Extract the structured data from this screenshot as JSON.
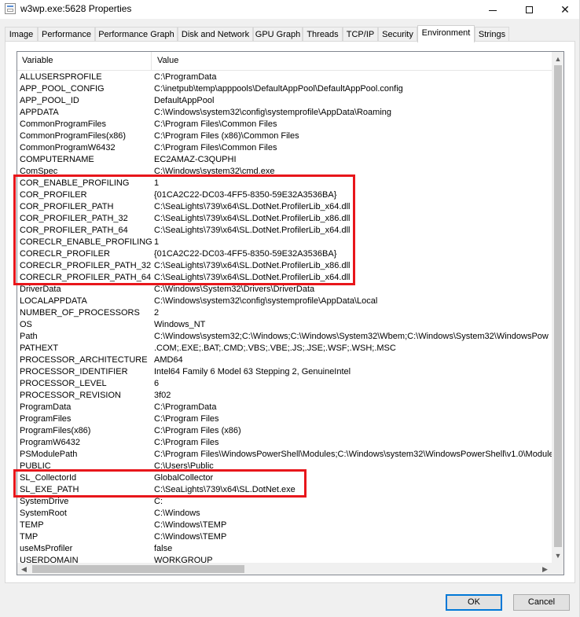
{
  "window": {
    "title": "w3wp.exe:5628 Properties"
  },
  "tabs": [
    {
      "label": "Image"
    },
    {
      "label": "Performance"
    },
    {
      "label": "Performance Graph"
    },
    {
      "label": "Disk and Network"
    },
    {
      "label": "GPU Graph"
    },
    {
      "label": "Threads"
    },
    {
      "label": "TCP/IP"
    },
    {
      "label": "Security"
    },
    {
      "label": "Environment"
    },
    {
      "label": "Strings"
    }
  ],
  "active_tab": "Environment",
  "table": {
    "columns": [
      "Variable",
      "Value"
    ],
    "rows": [
      [
        "ALLUSERSPROFILE",
        "C:\\ProgramData"
      ],
      [
        "APP_POOL_CONFIG",
        "C:\\inetpub\\temp\\apppools\\DefaultAppPool\\DefaultAppPool.config"
      ],
      [
        "APP_POOL_ID",
        "DefaultAppPool"
      ],
      [
        "APPDATA",
        "C:\\Windows\\system32\\config\\systemprofile\\AppData\\Roaming"
      ],
      [
        "CommonProgramFiles",
        "C:\\Program Files\\Common Files"
      ],
      [
        "CommonProgramFiles(x86)",
        "C:\\Program Files (x86)\\Common Files"
      ],
      [
        "CommonProgramW6432",
        "C:\\Program Files\\Common Files"
      ],
      [
        "COMPUTERNAME",
        "EC2AMAZ-C3QUPHI"
      ],
      [
        "ComSpec",
        "C:\\Windows\\system32\\cmd.exe"
      ],
      [
        "COR_ENABLE_PROFILING",
        "1"
      ],
      [
        "COR_PROFILER",
        "{01CA2C22-DC03-4FF5-8350-59E32A3536BA}"
      ],
      [
        "COR_PROFILER_PATH",
        "C:\\SeaLights\\739\\x64\\SL.DotNet.ProfilerLib_x64.dll"
      ],
      [
        "COR_PROFILER_PATH_32",
        "C:\\SeaLights\\739\\x64\\SL.DotNet.ProfilerLib_x86.dll"
      ],
      [
        "COR_PROFILER_PATH_64",
        "C:\\SeaLights\\739\\x64\\SL.DotNet.ProfilerLib_x64.dll"
      ],
      [
        "CORECLR_ENABLE_PROFILING",
        "1"
      ],
      [
        "CORECLR_PROFILER",
        "{01CA2C22-DC03-4FF5-8350-59E32A3536BA}"
      ],
      [
        "CORECLR_PROFILER_PATH_32",
        "C:\\SeaLights\\739\\x64\\SL.DotNet.ProfilerLib_x86.dll"
      ],
      [
        "CORECLR_PROFILER_PATH_64",
        "C:\\SeaLights\\739\\x64\\SL.DotNet.ProfilerLib_x64.dll"
      ],
      [
        "DriverData",
        "C:\\Windows\\System32\\Drivers\\DriverData"
      ],
      [
        "LOCALAPPDATA",
        "C:\\Windows\\system32\\config\\systemprofile\\AppData\\Local"
      ],
      [
        "NUMBER_OF_PROCESSORS",
        "2"
      ],
      [
        "OS",
        "Windows_NT"
      ],
      [
        "Path",
        "C:\\Windows\\system32;C:\\Windows;C:\\Windows\\System32\\Wbem;C:\\Windows\\System32\\WindowsPow"
      ],
      [
        "PATHEXT",
        ".COM;.EXE;.BAT;.CMD;.VBS;.VBE;.JS;.JSE;.WSF;.WSH;.MSC"
      ],
      [
        "PROCESSOR_ARCHITECTURE",
        "AMD64"
      ],
      [
        "PROCESSOR_IDENTIFIER",
        "Intel64 Family 6 Model 63 Stepping 2, GenuineIntel"
      ],
      [
        "PROCESSOR_LEVEL",
        "6"
      ],
      [
        "PROCESSOR_REVISION",
        "3f02"
      ],
      [
        "ProgramData",
        "C:\\ProgramData"
      ],
      [
        "ProgramFiles",
        "C:\\Program Files"
      ],
      [
        "ProgramFiles(x86)",
        "C:\\Program Files (x86)"
      ],
      [
        "ProgramW6432",
        "C:\\Program Files"
      ],
      [
        "PSModulePath",
        "C:\\Program Files\\WindowsPowerShell\\Modules;C:\\Windows\\system32\\WindowsPowerShell\\v1.0\\Module"
      ],
      [
        "PUBLIC",
        "C:\\Users\\Public"
      ],
      [
        "SL_CollectorId",
        "GlobalCollector"
      ],
      [
        "SL_EXE_PATH",
        "C:\\SeaLights\\739\\x64\\SL.DotNet.exe"
      ],
      [
        "SystemDrive",
        "C:"
      ],
      [
        "SystemRoot",
        "C:\\Windows"
      ],
      [
        "TEMP",
        "C:\\Windows\\TEMP"
      ],
      [
        "TMP",
        "C:\\Windows\\TEMP"
      ],
      [
        "useMsProfiler",
        "false"
      ],
      [
        "USERDOMAIN",
        "WORKGROUP"
      ]
    ]
  },
  "buttons": {
    "ok": "OK",
    "cancel": "Cancel"
  },
  "icons": {
    "app": "process-properties-icon",
    "minimize": "minimize-icon",
    "maximize": "maximize-icon",
    "close": "close-icon",
    "scroll_up": "triangle-up-icon",
    "scroll_down": "triangle-down-icon",
    "scroll_left": "triangle-left-icon",
    "scroll_right": "triangle-right-icon"
  },
  "colors": {
    "highlight": "#e8161b",
    "default_button_border": "#0078d7"
  }
}
